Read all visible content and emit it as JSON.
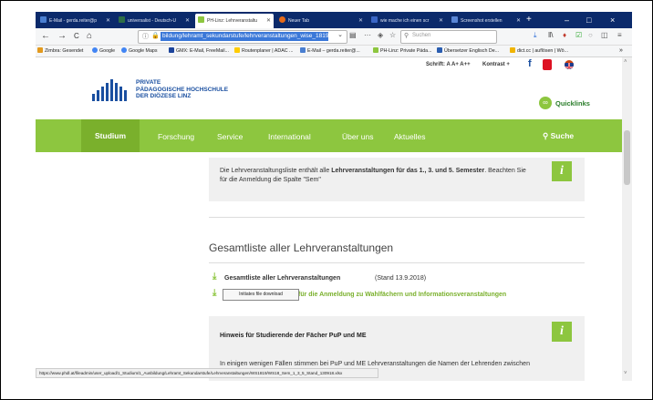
{
  "tabs": [
    {
      "label": "E-Mail - gerda.reiter@p",
      "color": "#4a7fd1",
      "active": false
    },
    {
      "label": "universalist - Deutsch-U",
      "color": "#2d6e46",
      "active": false
    },
    {
      "label": "PH-Linz: Lehrveranstaltu",
      "color": "#8dc63f",
      "active": true
    },
    {
      "label": "Neuer Tab",
      "color": "#e56a1a",
      "active": false
    },
    {
      "label": "wie mache ich einen scr",
      "color": "#3a66c6",
      "active": false
    },
    {
      "label": "Screenshot erstellen",
      "color": "#5a86d6",
      "active": false
    }
  ],
  "window": {
    "new_tab": "+",
    "minimize": "–",
    "maximize": "□",
    "close": "×"
  },
  "nav": {
    "back": "←",
    "forward": "→",
    "reload": "C",
    "home": "⌂",
    "url": "bildung/lehramt_sekundarstufe/lehrveranstaltungen_wise_1819/",
    "search_placeholder": "Suchen"
  },
  "bookmarks": [
    {
      "label": "Zimbra: Gesendet",
      "color": "#e39a1e"
    },
    {
      "label": "Google",
      "color": "#4285f4"
    },
    {
      "label": "Google Maps",
      "color": "#4285f4"
    },
    {
      "label": "GMX: E-Mail, FreeMail...",
      "color": "#1c449b"
    },
    {
      "label": "Routenplaner | ADAC ...",
      "color": "#ffcc00"
    },
    {
      "label": "E-Mail – gerda.reiter@...",
      "color": "#4a7fd1"
    },
    {
      "label": "PH-Linz: Private Päda...",
      "color": "#8dc63f"
    },
    {
      "label": "Übersetzer Englisch De...",
      "color": "#2a5db0"
    },
    {
      "label": "dict.cc | auflösen | Wö...",
      "color": "#f0b400"
    }
  ],
  "site": {
    "schrift_label": "Schrift:",
    "font_sizes": "A  A+  A++",
    "contrast": "Kontrast +",
    "logo_line1": "PRIVATE",
    "logo_line2": "PÄDAGOGISCHE HOCHSCHULE",
    "logo_line3": "DER DIÖZESE LINZ",
    "quicklinks": "Quicklinks"
  },
  "mainnav": [
    {
      "label": "Studium",
      "active": true
    },
    {
      "label": "Forschung",
      "active": false
    },
    {
      "label": "Service",
      "active": false
    },
    {
      "label": "International",
      "active": false
    },
    {
      "label": "Über uns",
      "active": false
    },
    {
      "label": "Aktuelles",
      "active": false
    }
  ],
  "search_label": "Suche",
  "info": {
    "text_pre": "Die Lehrveranstaltungsliste enthält alle ",
    "text_bold": "Lehrveranstaltungen für das 1., 3. und 5. Semester",
    "text_post": ". Beachten Sie für die Anmeldung die Spalte \"Sem\"",
    "badge": "i"
  },
  "section": {
    "heading": "Gesamtliste aller Lehrveranstaltungen",
    "download_label": "Gesamtliste aller Lehrveranstaltungen",
    "stand": "(Stand 13.9.2018)",
    "link2": "für die Anmeldung zu Wahlfächern und Informationsveranstaltungen",
    "tooltip": "Initiates file download"
  },
  "hint": {
    "title": "Hinweis für Studierende der Fächer PuP und ME",
    "body": "In einigen wenigen Fällen stimmen bei PuP und ME Lehrveranstaltungen die Namen der Lehrenden zwischen",
    "badge": "i"
  },
  "status_url": "https://www.phdl.at/fileadmin/user_upload/1_Studium/1_Ausbildung/Lehramt_Sekundarstufe/Lehrveranstaltungen/WS1819/WS18_Sem_1_3_5_Stand_130918.xlsx",
  "colors": {
    "green": "#8dc63f",
    "blue": "#1a4fa0",
    "tabbar": "#0b2a6b"
  }
}
